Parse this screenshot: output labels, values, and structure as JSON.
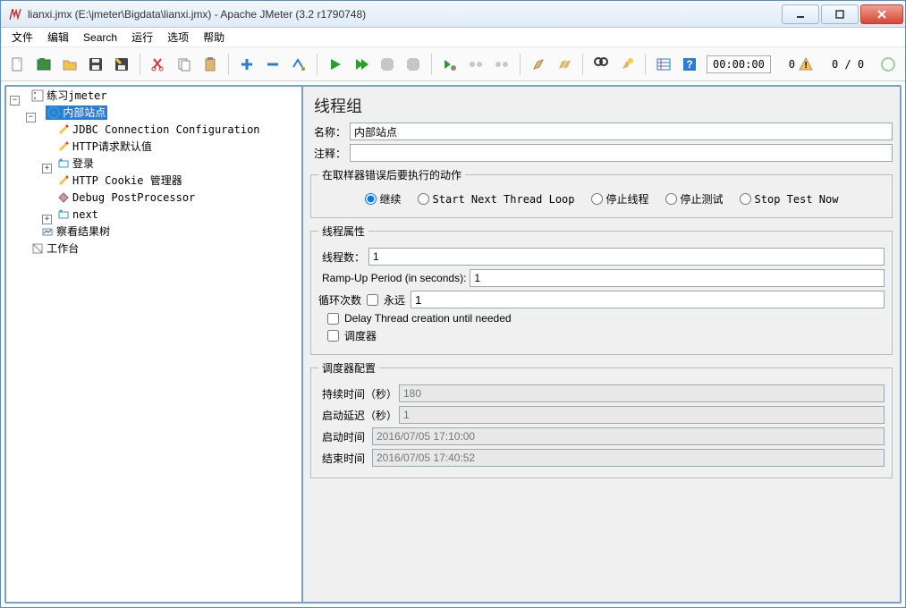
{
  "title": "lianxi.jmx (E:\\jmeter\\Bigdata\\lianxi.jmx) - Apache JMeter (3.2 r1790748)",
  "menu": {
    "file": "文件",
    "edit": "编辑",
    "search": "Search",
    "run": "运行",
    "options": "选项",
    "help": "帮助"
  },
  "timer": "00:00:00",
  "toolbar_zero": "0",
  "toolbar_ratio": "0 / 0",
  "tree": {
    "root": "练习jmeter",
    "selected": "内部站点",
    "children": [
      "JDBC Connection Configuration",
      "HTTP请求默认值",
      "登录",
      "HTTP Cookie 管理器",
      "Debug PostProcessor",
      "next"
    ],
    "sibling1": "察看结果树",
    "workbench": "工作台"
  },
  "panel": {
    "title": "线程组",
    "name_label": "名称：",
    "name_value": "内部站点",
    "comment_label": "注释：",
    "comment_value": "",
    "on_error_legend": "在取样器错误后要执行的动作",
    "radios": {
      "continue": "继续",
      "next_loop": "Start Next Thread Loop",
      "stop_thread": "停止线程",
      "stop_test": "停止测试",
      "stop_now": "Stop Test Now"
    },
    "thread_props_legend": "线程属性",
    "threads_label": "线程数：",
    "threads_value": "1",
    "rampup_label": "Ramp-Up Period (in seconds):",
    "rampup_value": "1",
    "loops_label": "循环次数",
    "forever_label": "永远",
    "loops_value": "1",
    "delay_create_label": "Delay Thread creation until needed",
    "scheduler_label": "调度器",
    "scheduler_legend": "调度器配置",
    "duration_label": "持续时间（秒）",
    "duration_value": "180",
    "delay_label": "启动延迟（秒）",
    "delay_value": "1",
    "start_time_label": "启动时间",
    "start_time_value": "2016/07/05 17:10:00",
    "end_time_label": "结束时间",
    "end_time_value": "2016/07/05 17:40:52"
  }
}
